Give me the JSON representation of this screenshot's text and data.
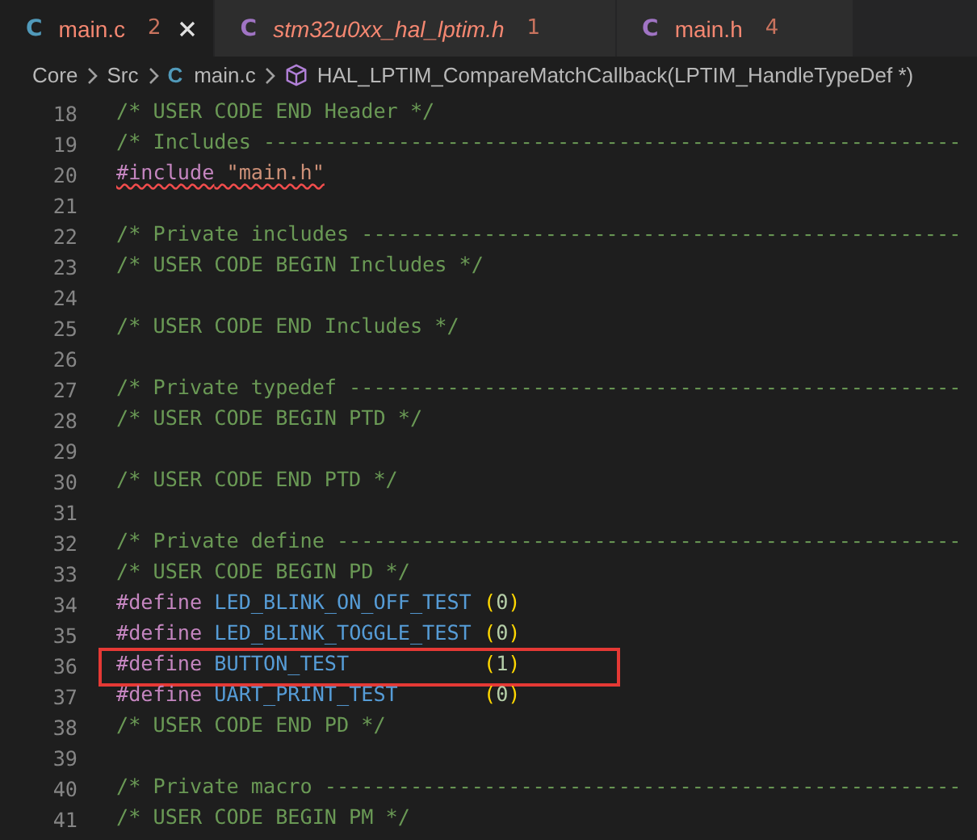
{
  "tabs": [
    {
      "icon": "C",
      "color": "#519aba",
      "label": "main.c",
      "problems": "2",
      "selected": true,
      "preview": false
    },
    {
      "icon": "C",
      "color": "#a074c4",
      "label": "stm32u0xx_hal_lptim.h",
      "problems": "1",
      "selected": false,
      "preview": true
    },
    {
      "icon": "C",
      "color": "#a074c4",
      "label": "main.h",
      "problems": "4",
      "selected": false,
      "preview": false
    }
  ],
  "breadcrumb": [
    {
      "kind": "folder",
      "label": "Core"
    },
    {
      "kind": "folder",
      "label": "Src"
    },
    {
      "kind": "file",
      "icon": "C",
      "label": "main.c"
    },
    {
      "kind": "symbol",
      "label": "HAL_LPTIM_CompareMatchCallback(LPTIM_HandleTypeDef *)"
    }
  ],
  "editor": {
    "lines": [
      {
        "number": "18",
        "boxed": false,
        "tokens": [
          {
            "kind": "comment",
            "text": "/* USER CODE END Header */",
            "error": false
          }
        ]
      },
      {
        "number": "19",
        "boxed": false,
        "tokens": [
          {
            "kind": "comment",
            "text": "/* Includes ---------------------------------------------------------",
            "error": false
          }
        ]
      },
      {
        "number": "20",
        "boxed": false,
        "tokens": [
          {
            "kind": "directive",
            "text": "#include",
            "error": true
          },
          {
            "kind": "string",
            "text": " \"main.h\"",
            "error": true
          }
        ]
      },
      {
        "number": "21",
        "boxed": false
      },
      {
        "number": "22",
        "boxed": false,
        "tokens": [
          {
            "kind": "comment",
            "text": "/* Private includes -------------------------------------------------",
            "error": false
          }
        ]
      },
      {
        "number": "23",
        "boxed": false,
        "tokens": [
          {
            "kind": "comment",
            "text": "/* USER CODE BEGIN Includes */",
            "error": false
          }
        ]
      },
      {
        "number": "24",
        "boxed": false
      },
      {
        "number": "25",
        "boxed": false,
        "tokens": [
          {
            "kind": "comment",
            "text": "/* USER CODE END Includes */",
            "error": false
          }
        ]
      },
      {
        "number": "26",
        "boxed": false
      },
      {
        "number": "27",
        "boxed": false,
        "tokens": [
          {
            "kind": "comment",
            "text": "/* Private typedef --------------------------------------------------",
            "error": false
          }
        ]
      },
      {
        "number": "28",
        "boxed": false,
        "tokens": [
          {
            "kind": "comment",
            "text": "/* USER CODE BEGIN PTD */",
            "error": false
          }
        ]
      },
      {
        "number": "29",
        "boxed": false
      },
      {
        "number": "30",
        "boxed": false,
        "tokens": [
          {
            "kind": "comment",
            "text": "/* USER CODE END PTD */",
            "error": false
          }
        ]
      },
      {
        "number": "31",
        "boxed": false
      },
      {
        "number": "32",
        "boxed": false,
        "tokens": [
          {
            "kind": "comment",
            "text": "/* Private define ---------------------------------------------------",
            "error": false
          }
        ]
      },
      {
        "number": "33",
        "boxed": false,
        "tokens": [
          {
            "kind": "comment",
            "text": "/* USER CODE BEGIN PD */",
            "error": false
          }
        ]
      },
      {
        "number": "34",
        "boxed": false,
        "tokens": [
          {
            "kind": "directive",
            "text": "#define",
            "error": false
          },
          {
            "kind": "macro",
            "text": " LED_BLINK_ON_OFF_TEST ",
            "error": false
          },
          {
            "kind": "paren",
            "text": "(",
            "error": false
          },
          {
            "kind": "number",
            "text": "0",
            "error": false
          },
          {
            "kind": "paren",
            "text": ")",
            "error": false
          }
        ]
      },
      {
        "number": "35",
        "boxed": false,
        "tokens": [
          {
            "kind": "directive",
            "text": "#define",
            "error": false
          },
          {
            "kind": "macro",
            "text": " LED_BLINK_TOGGLE_TEST ",
            "error": false
          },
          {
            "kind": "paren",
            "text": "(",
            "error": false
          },
          {
            "kind": "number",
            "text": "0",
            "error": false
          },
          {
            "kind": "paren",
            "text": ")",
            "error": false
          }
        ]
      },
      {
        "number": "36",
        "boxed": true,
        "tokens": [
          {
            "kind": "directive",
            "text": "#define",
            "error": false
          },
          {
            "kind": "macro",
            "text": " BUTTON_TEST           ",
            "error": false
          },
          {
            "kind": "paren",
            "text": "(",
            "error": false
          },
          {
            "kind": "number",
            "text": "1",
            "error": false
          },
          {
            "kind": "paren",
            "text": ")",
            "error": false
          }
        ]
      },
      {
        "number": "37",
        "boxed": false,
        "tokens": [
          {
            "kind": "directive",
            "text": "#define",
            "error": false
          },
          {
            "kind": "macro",
            "text": " UART_PRINT_TEST       ",
            "error": false
          },
          {
            "kind": "paren",
            "text": "(",
            "error": false
          },
          {
            "kind": "number",
            "text": "0",
            "error": false
          },
          {
            "kind": "paren",
            "text": ")",
            "error": false
          }
        ]
      },
      {
        "number": "38",
        "boxed": false,
        "tokens": [
          {
            "kind": "comment",
            "text": "/* USER CODE END PD */",
            "error": false
          }
        ]
      },
      {
        "number": "39",
        "boxed": false
      },
      {
        "number": "40",
        "boxed": false,
        "tokens": [
          {
            "kind": "comment",
            "text": "/* Private macro ----------------------------------------------------",
            "error": false
          }
        ]
      },
      {
        "number": "41",
        "boxed": false,
        "tokens": [
          {
            "kind": "comment",
            "text": "/* USER CODE BEGIN PM */",
            "error": false
          }
        ]
      }
    ]
  }
}
